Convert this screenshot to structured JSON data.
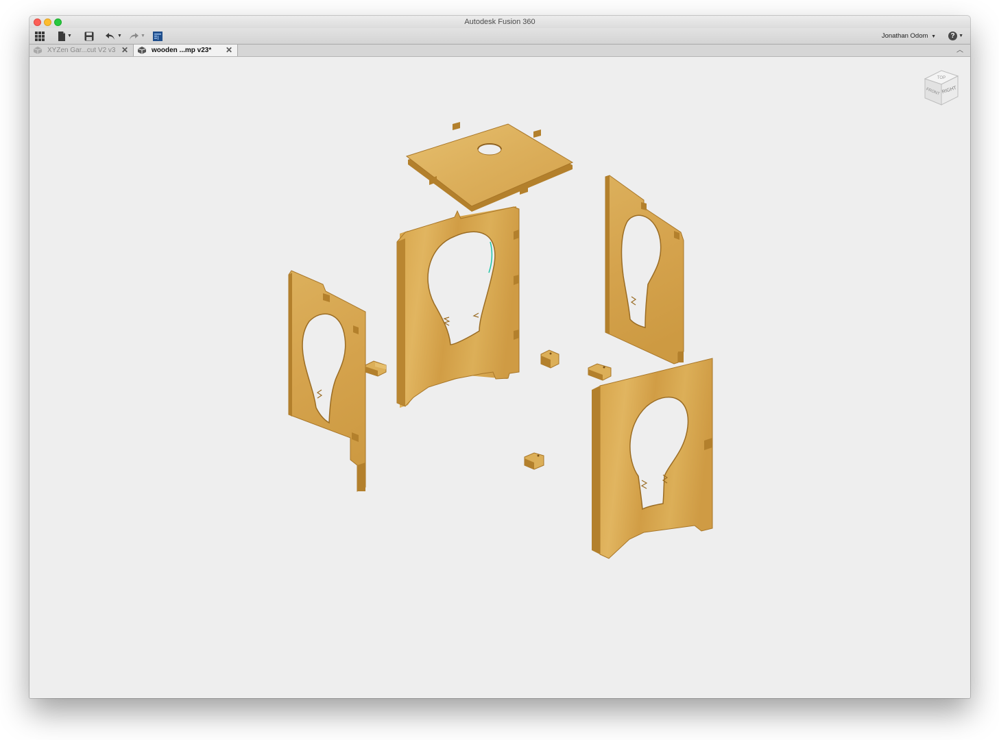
{
  "window": {
    "title": "Autodesk Fusion 360"
  },
  "toolbar": {
    "user_name": "Jonathan Odom",
    "icons": [
      "app-grid-icon",
      "file-icon",
      "save-icon",
      "undo-icon",
      "redo-icon",
      "data-panel-icon",
      "help-icon"
    ]
  },
  "tabs": [
    {
      "label": "XYZen Gar...cut V2 v3",
      "active": false
    },
    {
      "label": "wooden ...mp v23*",
      "active": true
    }
  ],
  "viewcube": {
    "top_label": "TOP",
    "front_label": "FRONT",
    "right_label": "RIGHT"
  },
  "colors": {
    "wood_face": "#d9a94e",
    "wood_edge": "#b9852f",
    "viewport_bg": "#eeeeee",
    "selection_highlight": "#20c4a8"
  }
}
